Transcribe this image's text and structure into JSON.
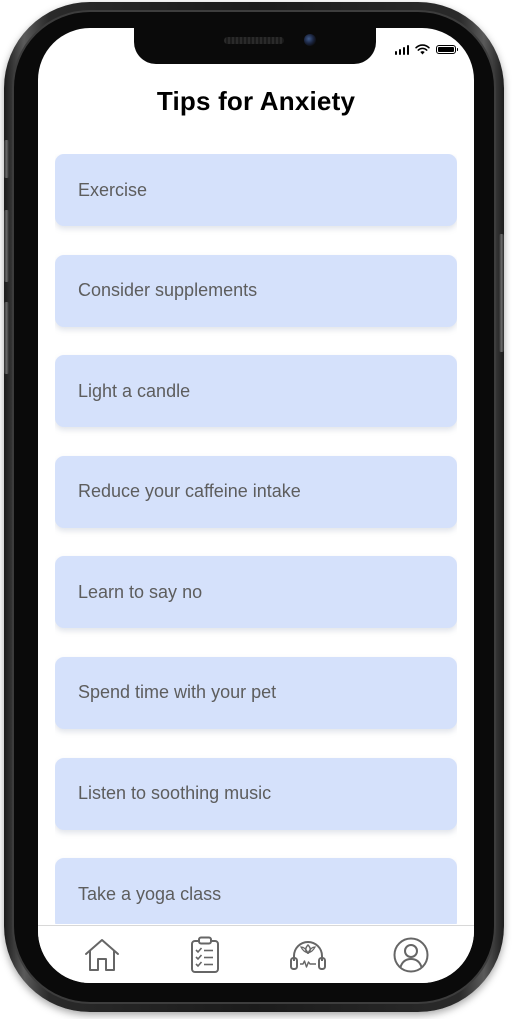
{
  "header": {
    "title": "Tips for Anxiety"
  },
  "tips": [
    {
      "label": "Exercise"
    },
    {
      "label": "Consider supplements"
    },
    {
      "label": "Light a candle"
    },
    {
      "label": "Reduce your caffeine intake"
    },
    {
      "label": "Learn to say no"
    },
    {
      "label": "Spend time with your pet"
    },
    {
      "label": "Listen to soothing music"
    },
    {
      "label": "Take a yoga class"
    }
  ],
  "bottom_nav": {
    "items": [
      {
        "icon": "home-icon"
      },
      {
        "icon": "checklist-icon"
      },
      {
        "icon": "meditation-headphones-icon"
      },
      {
        "icon": "profile-icon"
      }
    ]
  },
  "status_bar": {
    "icons": [
      "signal-icon",
      "wifi-icon",
      "battery-icon"
    ]
  },
  "colors": {
    "card_background": "#d5e1fb",
    "card_text": "#5d5d5d",
    "title_text": "#000000",
    "icon_stroke": "#666666"
  }
}
